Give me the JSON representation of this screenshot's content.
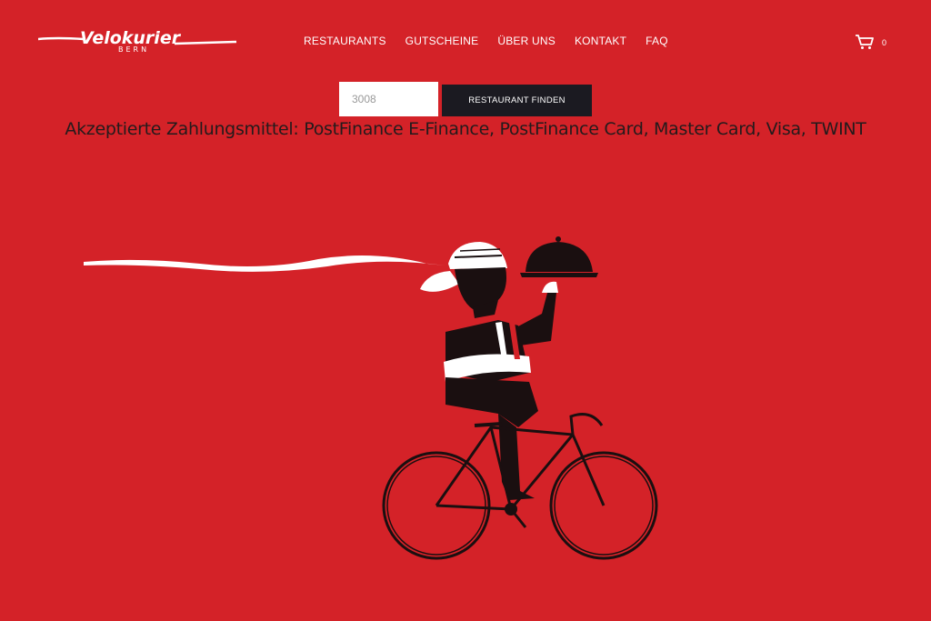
{
  "logo": {
    "name": "Velokurier",
    "sub": "BERN"
  },
  "nav": {
    "items": [
      {
        "label": "RESTAURANTS"
      },
      {
        "label": "GUTSCHEINE"
      },
      {
        "label": "ÜBER UNS"
      },
      {
        "label": "KONTAKT"
      },
      {
        "label": "FAQ"
      }
    ]
  },
  "cart": {
    "count": "0",
    "icon": "cart-icon"
  },
  "search": {
    "value": "3008",
    "button_label": "RESTAURANT FINDEN"
  },
  "payment_text": "Akzeptierte Zahlungsmittel: PostFinance E-Finance, PostFinance Card, Master Card, Visa, TWINT",
  "colors": {
    "background": "#d42228",
    "button": "#1b1a21",
    "text_dark": "#231b1c"
  }
}
